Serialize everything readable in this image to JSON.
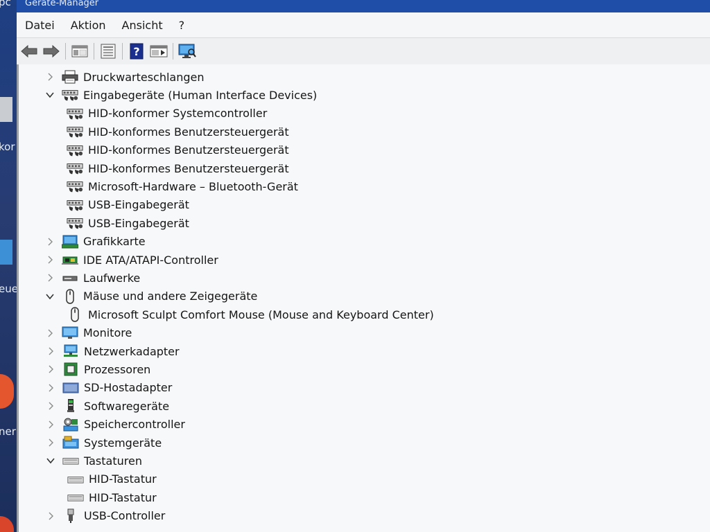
{
  "window": {
    "title": "Geräte-Manager"
  },
  "desktop": {
    "labels": [
      "pc",
      "kor",
      "eue",
      "ner"
    ]
  },
  "menu": [
    "Datei",
    "Aktion",
    "Ansicht",
    "?"
  ],
  "toolbar": {
    "buttons": [
      "back-arrow-icon",
      "forward-arrow-icon",
      "show-hide-console-tree-icon",
      "properties-icon",
      "help-icon",
      "action-pane-icon",
      "scan-hardware-monitor-icon"
    ]
  },
  "tree": [
    {
      "label": "Druckwarteschlangen",
      "level": 0,
      "state": "collapsed",
      "icon": "printer-icon"
    },
    {
      "label": "Eingabegeräte (Human Interface Devices)",
      "level": 0,
      "state": "expanded",
      "icon": "hid-icon"
    },
    {
      "label": "HID-konformer Systemcontroller",
      "level": 1,
      "state": "leaf",
      "icon": "hid-icon"
    },
    {
      "label": "HID-konformes Benutzersteuergerät",
      "level": 1,
      "state": "leaf",
      "icon": "hid-icon"
    },
    {
      "label": "HID-konformes Benutzersteuergerät",
      "level": 1,
      "state": "leaf",
      "icon": "hid-icon"
    },
    {
      "label": "HID-konformes Benutzersteuergerät",
      "level": 1,
      "state": "leaf",
      "icon": "hid-icon"
    },
    {
      "label": "Microsoft-Hardware – Bluetooth-Gerät",
      "level": 1,
      "state": "leaf",
      "icon": "hid-icon"
    },
    {
      "label": "USB-Eingabegerät",
      "level": 1,
      "state": "leaf",
      "icon": "hid-icon"
    },
    {
      "label": "USB-Eingabegerät",
      "level": 1,
      "state": "leaf",
      "icon": "hid-icon"
    },
    {
      "label": "Grafikkarte",
      "level": 0,
      "state": "collapsed",
      "icon": "display-adapter-icon"
    },
    {
      "label": "IDE ATA/ATAPI-Controller",
      "level": 0,
      "state": "collapsed",
      "icon": "ide-controller-icon"
    },
    {
      "label": "Laufwerke",
      "level": 0,
      "state": "collapsed",
      "icon": "disk-drive-icon"
    },
    {
      "label": "Mäuse und andere Zeigegeräte",
      "level": 0,
      "state": "expanded",
      "icon": "mouse-icon"
    },
    {
      "label": "Microsoft Sculpt Comfort Mouse (Mouse and Keyboard Center)",
      "level": 1,
      "state": "leaf",
      "icon": "mouse-icon"
    },
    {
      "label": "Monitore",
      "level": 0,
      "state": "collapsed",
      "icon": "monitor-icon"
    },
    {
      "label": "Netzwerkadapter",
      "level": 0,
      "state": "collapsed",
      "icon": "network-adapter-icon"
    },
    {
      "label": "Prozessoren",
      "level": 0,
      "state": "collapsed",
      "icon": "processor-icon"
    },
    {
      "label": "SD-Hostadapter",
      "level": 0,
      "state": "collapsed",
      "icon": "sd-host-icon"
    },
    {
      "label": "Softwaregeräte",
      "level": 0,
      "state": "collapsed",
      "icon": "software-device-icon"
    },
    {
      "label": "Speichercontroller",
      "level": 0,
      "state": "collapsed",
      "icon": "storage-controller-icon"
    },
    {
      "label": "Systemgeräte",
      "level": 0,
      "state": "collapsed",
      "icon": "system-device-icon"
    },
    {
      "label": "Tastaturen",
      "level": 0,
      "state": "expanded",
      "icon": "keyboard-icon"
    },
    {
      "label": "HID-Tastatur",
      "level": 1,
      "state": "leaf",
      "icon": "keyboard-icon"
    },
    {
      "label": "HID-Tastatur",
      "level": 1,
      "state": "leaf",
      "icon": "keyboard-icon"
    },
    {
      "label": "USB-Controller",
      "level": 0,
      "state": "collapsed",
      "icon": "usb-icon"
    }
  ]
}
